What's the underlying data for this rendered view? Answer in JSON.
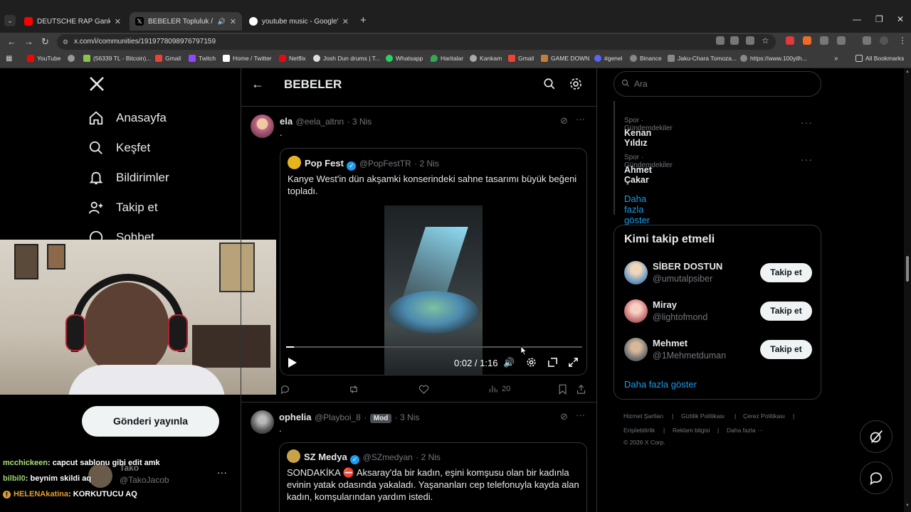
{
  "browser": {
    "tabs": [
      {
        "label": "DEUTSCHE RAP Gankster Brudi",
        "color": "#ff0000"
      },
      {
        "label": "BEBELER Topluluk / X",
        "color": "#ffffff"
      },
      {
        "label": "youtube music - Google'da Ara",
        "color": "#4285f4"
      }
    ],
    "url": "x.com/i/communities/1919778098976797159",
    "bookmarks": [
      {
        "label": "YouTube",
        "color": "#ff0000"
      },
      {
        "label": "",
        "color": "#999999"
      },
      {
        "label": "(56339 TL - Bitcoin)...",
        "color": "#8bc34a"
      },
      {
        "label": "Gmail",
        "color": "#ea4335"
      },
      {
        "label": "Twitch",
        "color": "#9146ff"
      },
      {
        "label": "Home / Twitter",
        "color": "#ffffff"
      },
      {
        "label": "Netflix",
        "color": "#e50914"
      },
      {
        "label": "Josh Dun drums | T...",
        "color": "#dddddd"
      },
      {
        "label": "Whatsapp",
        "color": "#25d366"
      },
      {
        "label": "Haritalar",
        "color": "#34a853"
      },
      {
        "label": "Kankam",
        "color": "#aaaaaa"
      },
      {
        "label": "Gmail",
        "color": "#ea4335"
      },
      {
        "label": "GAME DOWN",
        "color": "#c77d3a"
      },
      {
        "label": "#genel",
        "color": "#5865f2"
      },
      {
        "label": "Binance",
        "color": "#888888"
      },
      {
        "label": "Jaku-Chara Tomoza...",
        "color": "#888888"
      },
      {
        "label": "https://www.100yilh...",
        "color": "#888888"
      }
    ],
    "all_bookmarks": "All Bookmarks"
  },
  "nav": {
    "home": "Anasayfa",
    "explore": "Keşfet",
    "notifications": "Bildirimler",
    "follow": "Takip et",
    "chat": "Sohbet",
    "post_button": "Gönderi yayınla"
  },
  "community": {
    "title": "BEBELER"
  },
  "tweets": [
    {
      "name": "ela",
      "handle": "@eela_altnn",
      "time": "· 3 Nis",
      "text": ".",
      "quote": {
        "name": "Pop Fest",
        "handle": "@PopFestTR",
        "time": "· 2 Nis",
        "text": "Kanye West'in dün akşamki konserindeki sahne tasarımı büyük beğeni topladı.",
        "video_time": "0:02 / 1:16",
        "video_progress": 0.026
      },
      "views": "20"
    },
    {
      "name": "ophelia",
      "handle": "@Playboi_8",
      "badge": "Mod",
      "time": "· 3 Nis",
      "text": ".",
      "quote": {
        "name": "SZ Medya",
        "handle": "@SZmedyan",
        "time": "· 2 Nis",
        "text": "SONDAKİKA ⛔ Aksaray'da bir kadın, eşini komşusu olan bir kadınla evinin yatak odasında yakaladı. Yaşananları cep telefonuyla kayda alan kadın, komşularından yardım istedi."
      }
    }
  ],
  "search": {
    "placeholder": "Ara"
  },
  "trends": [
    {
      "category": "Spor · Gündemdekiler",
      "name": "Kenan Yıldız"
    },
    {
      "category": "Spor · Gündemdekiler",
      "name": "Ahmet Çakar"
    }
  ],
  "show_more": "Daha fazla göster",
  "who_to_follow": {
    "title": "Kimi takip etmeli",
    "button": "Takip et",
    "users": [
      {
        "name": "SİBER DOSTUN",
        "handle": "@umutalpsiber"
      },
      {
        "name": "Miray",
        "handle": "@lightofmond"
      },
      {
        "name": "Mehmet",
        "handle": "@1Mehmetduman"
      }
    ]
  },
  "footer": {
    "terms": "Hizmet Şartları",
    "privacy": "Gizlilik Politikası",
    "cookies": "Çerez Politikası",
    "accessibility": "Erişilebilirlik",
    "ads": "Reklam bilgisi",
    "more": "Daha fazla ···",
    "copyright": "© 2026 X Corp."
  },
  "account": {
    "name": "Tako",
    "handle": "@TakoJacob"
  },
  "chat": [
    {
      "user": "mcchickeen",
      "message": ": capcut sablonu gibi edit amk",
      "color": "#a8e07a"
    },
    {
      "user": "bilbil0",
      "message": ": beynim skildi aq",
      "color": "#9bd36b"
    },
    {
      "user": "HELENAkatina",
      "message": ": KORKUTUCU AQ",
      "color": "#e0a030"
    }
  ]
}
